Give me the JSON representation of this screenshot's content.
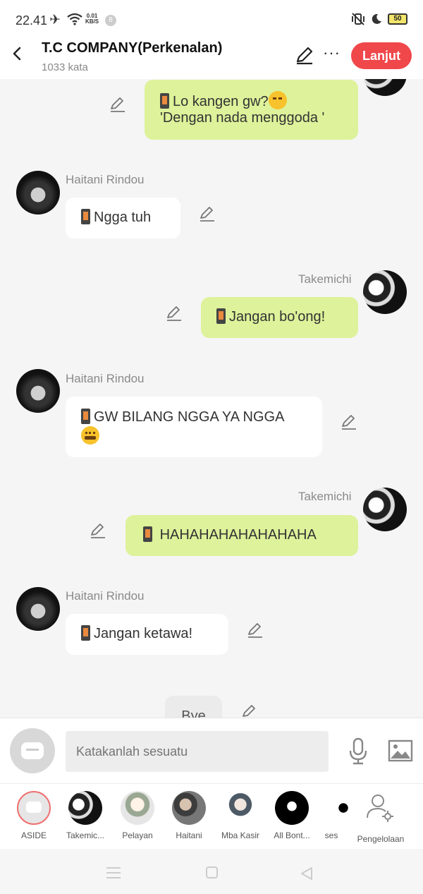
{
  "status_bar": {
    "time": "22.41",
    "speed_value": "0.01",
    "speed_unit": "KB/S",
    "notification_count": "8",
    "battery": "50"
  },
  "header": {
    "title": "T.C COMPANY(Perkenalan)",
    "subtitle": "1033 kata",
    "next_button": "Lanjut"
  },
  "messages": [
    {
      "side": "right",
      "sender": "",
      "line1": "Lo kangen gw?",
      "emoji1": "smirking-face",
      "line2": "'Dengan nada menggoda '"
    },
    {
      "side": "left",
      "sender": "Haitani Rindou",
      "text": "Ngga tuh"
    },
    {
      "side": "right",
      "sender": "Takemichi",
      "text": "Jangan bo'ong!"
    },
    {
      "side": "left",
      "sender": "Haitani Rindou",
      "text": "GW BILANG NGGA YA NGGA",
      "emoji": "zipper-mouth-face"
    },
    {
      "side": "right",
      "sender": "Takemichi",
      "text": "HAHAHAHAHAHAHAHA"
    },
    {
      "side": "left",
      "sender": "Haitani Rindou",
      "text": "Jangan ketawa!"
    },
    {
      "side": "center",
      "sender": "",
      "text": "Bye"
    }
  ],
  "input": {
    "placeholder": "Katakanlah sesuatu"
  },
  "characters": [
    {
      "label": "ASIDE"
    },
    {
      "label": "Takemic..."
    },
    {
      "label": "Pelayan"
    },
    {
      "label": "Haitani"
    },
    {
      "label": "Mba Kasir"
    },
    {
      "label": "All Bont..."
    },
    {
      "label": "ses"
    },
    {
      "label": "Pengelolaan"
    }
  ],
  "colors": {
    "accent": "#f0474b",
    "bubble_right": "#ddf29a",
    "bubble_left": "#ffffff",
    "background": "#f5f5f5"
  }
}
